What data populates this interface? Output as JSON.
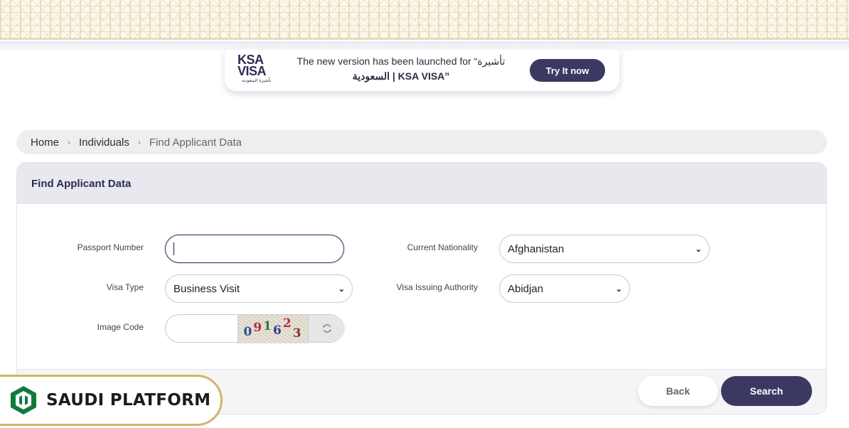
{
  "promo": {
    "logo_line1": "KSA",
    "logo_line2": "VISA",
    "logo_line3": "تأشيرة السعودية",
    "text_line1": "The new version has been launched for “تأشيرة",
    "text_line2": "السعودية | KSA VISA”",
    "try_label": "Try It now"
  },
  "breadcrumb": {
    "items": [
      "Home",
      "Individuals"
    ],
    "separator": "›",
    "current": "Find Applicant Data"
  },
  "panel": {
    "title": "Find Applicant Data"
  },
  "form": {
    "passport_label": "Passport Number",
    "passport_value": "",
    "nationality_label": "Current Nationality",
    "nationality_value": "Afghanistan",
    "visa_type_label": "Visa Type",
    "visa_type_value": "Business Visit",
    "authority_label": "Visa Issuing Authority",
    "authority_value": "Abidjan",
    "image_code_label": "Image Code",
    "image_code_value": "",
    "captcha_digits": [
      "0",
      "9",
      "1",
      "6",
      "2",
      "3"
    ]
  },
  "actions": {
    "back_label": "Back",
    "search_label": "Search"
  },
  "watermark": {
    "text": "SAUDI PLATFORM"
  },
  "icons": {
    "dropdown": "chevron-down-icon",
    "refresh": "refresh-icon",
    "breadcrumb_sep": "chevron-right-icon"
  },
  "colors": {
    "primary": "#3b3862",
    "accent_gold": "#d4b564",
    "watermark_green": "#0f7a3c"
  }
}
